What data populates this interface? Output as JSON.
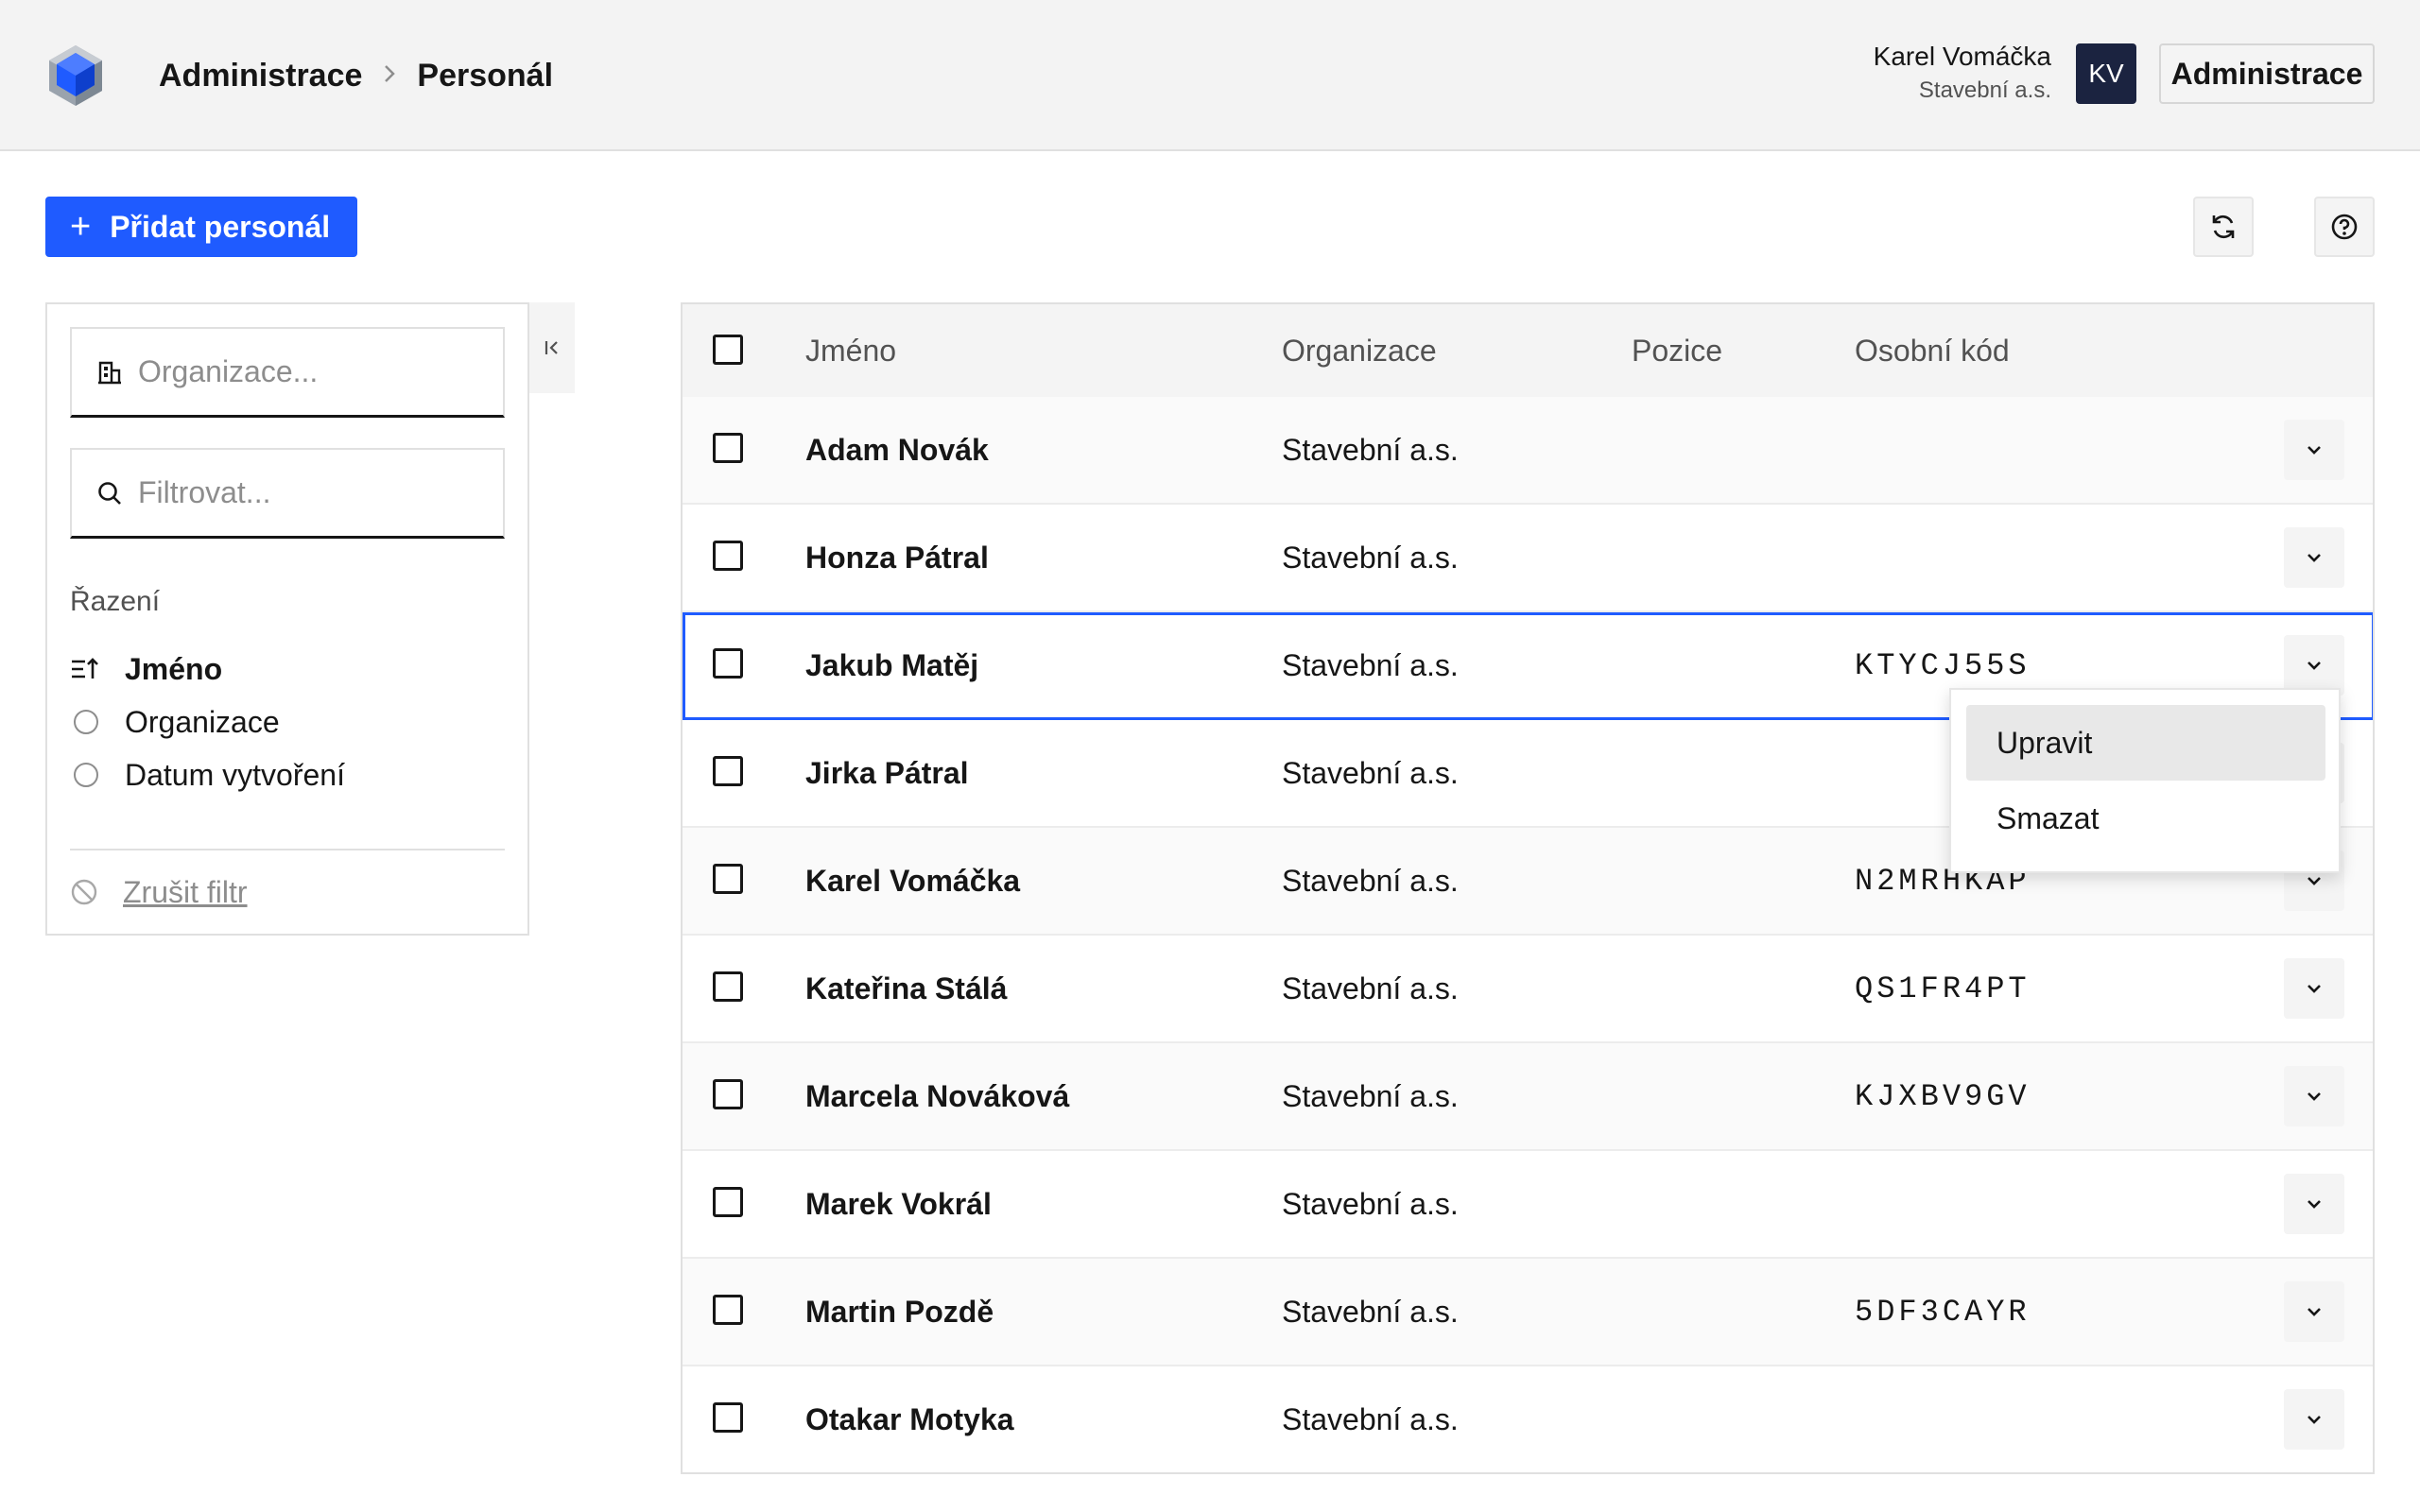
{
  "header": {
    "breadcrumb": [
      "Administrace",
      "Personál"
    ],
    "user": {
      "name": "Karel Vomáčka",
      "organization": "Stavební a.s.",
      "initials": "KV"
    },
    "admin_button": "Administrace"
  },
  "toolbar": {
    "add_button": "Přidat personál",
    "refresh_icon": "refresh-icon",
    "help_icon": "help-icon"
  },
  "filters": {
    "organization_placeholder": "Organizace...",
    "search_placeholder": "Filtrovat...",
    "sort_heading": "Řazení",
    "sort_options": [
      "Jméno",
      "Organizace",
      "Datum vytvoření"
    ],
    "sort_selected": "Jméno",
    "clear_filter": "Zrušit filtr"
  },
  "table": {
    "columns": [
      "Jméno",
      "Organizace",
      "Pozice",
      "Osobní kód"
    ],
    "rows": [
      {
        "name": "Adam Novák",
        "organization": "Stavební a.s.",
        "position": "",
        "code": ""
      },
      {
        "name": "Honza Pátral",
        "organization": "Stavební a.s.",
        "position": "",
        "code": ""
      },
      {
        "name": "Jakub Matěj",
        "organization": "Stavební a.s.",
        "position": "",
        "code": "KTYCJ55S"
      },
      {
        "name": "Jirka Pátral",
        "organization": "Stavební a.s.",
        "position": "",
        "code": ""
      },
      {
        "name": "Karel Vomáčka",
        "organization": "Stavební a.s.",
        "position": "",
        "code": "N2MRHKAP"
      },
      {
        "name": "Kateřina Stálá",
        "organization": "Stavební a.s.",
        "position": "",
        "code": "QS1FR4PT"
      },
      {
        "name": "Marcela Nováková",
        "organization": "Stavební a.s.",
        "position": "",
        "code": "KJXBV9GV"
      },
      {
        "name": "Marek Vokrál",
        "organization": "Stavební a.s.",
        "position": "",
        "code": ""
      },
      {
        "name": "Martin Pozdě",
        "organization": "Stavební a.s.",
        "position": "",
        "code": "5DF3CAYR"
      },
      {
        "name": "Otakar Motyka",
        "organization": "Stavební a.s.",
        "position": "",
        "code": ""
      }
    ],
    "selected_row": 2
  },
  "row_menu": {
    "items": [
      "Upravit",
      "Smazat"
    ]
  },
  "colors": {
    "accent": "#1f5bff",
    "avatar": "#1b2340",
    "header_bg": "#f3f3f3"
  }
}
